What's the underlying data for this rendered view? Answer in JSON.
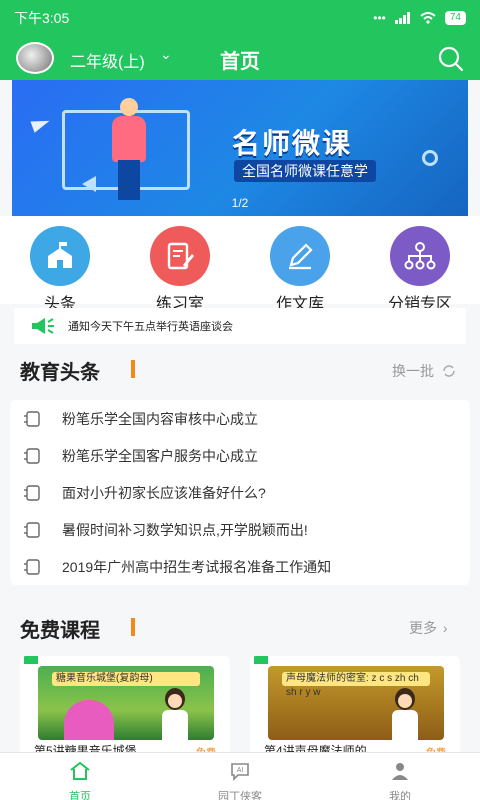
{
  "status_bar": {
    "time": "下午3:05",
    "icons_text": "... ◇ ⏰ ıll ıll",
    "battery": "74"
  },
  "app_bar": {
    "grade": "二年级(上)",
    "title": "首页"
  },
  "banner": {
    "headline": "名师微课",
    "subline": "全国名师微课任意学",
    "page_indicator": "1/2"
  },
  "quick_links": [
    {
      "label": "头条",
      "icon": "school-icon",
      "color": "#3ea7e6"
    },
    {
      "label": "练习室",
      "icon": "edit-doc-icon",
      "color": "#ef5a5a"
    },
    {
      "label": "作文库",
      "icon": "pencil-icon",
      "color": "#4aa3ea"
    },
    {
      "label": "分销专区",
      "icon": "network-icon",
      "color": "#7d5bc7"
    }
  ],
  "notice": {
    "text": "通知今天下午五点举行英语座谈会"
  },
  "news_section": {
    "title": "教育头条",
    "refresh_label": "换一批",
    "items": [
      "粉笔乐学全国内容审核中心成立",
      "粉笔乐学全国客户服务中心成立",
      "面对小升初家长应该准备好什么?",
      "暑假时间补习数学知识点,开学脱颖而出!",
      "2019年广州高中招生考试报名准备工作通知"
    ]
  },
  "courses_section": {
    "title": "免费课程",
    "more_label": "更多",
    "courses": [
      {
        "tag": "官方",
        "thumb_text": "糖果音乐城堡(复韵母)",
        "title": "第5讲糖果音乐城堡...",
        "price": "免费"
      },
      {
        "tag": "官方",
        "thumb_text": "声母魔法师的密室: z c s zh ch sh r y w",
        "title": "第4讲声母魔法师的...",
        "price": "免费"
      }
    ]
  },
  "tab_bar": [
    {
      "label": "首页",
      "icon": "home-icon",
      "active": true
    },
    {
      "label": "园丁侠客",
      "icon": "ai-chat-icon",
      "active": false
    },
    {
      "label": "我的",
      "icon": "user-icon",
      "active": false
    }
  ],
  "colors": {
    "primary": "#22c55e",
    "accent": "#f28a1a"
  }
}
